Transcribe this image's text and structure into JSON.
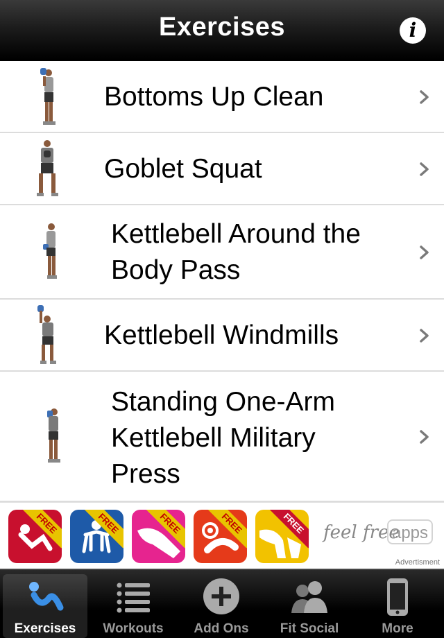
{
  "header": {
    "title": "Exercises",
    "info_icon": "info-icon"
  },
  "exercises": [
    {
      "label": "Bottoms Up Clean"
    },
    {
      "label": "Goblet Squat"
    },
    {
      "label": "Kettlebell Around the\nBody Pass"
    },
    {
      "label": "Kettlebell Windmills"
    },
    {
      "label": "Standing One-Arm\nKettlebell Military\nPress"
    }
  ],
  "ad": {
    "badge": "FREE",
    "brand": "feel free",
    "brand_apps": "apps",
    "label": "Advertisment",
    "icon_colors": [
      "#c8102e",
      "#1e5aa8",
      "#e6248f",
      "#e53a1a",
      "#f2c200"
    ]
  },
  "tabs": [
    {
      "label": "Exercises",
      "icon": "exercise-figure-icon",
      "active": true
    },
    {
      "label": "Workouts",
      "icon": "list-icon"
    },
    {
      "label": "Add Ons",
      "icon": "plus-circle-icon"
    },
    {
      "label": "Fit Social",
      "icon": "people-icon"
    },
    {
      "label": "More",
      "icon": "phone-icon"
    }
  ]
}
